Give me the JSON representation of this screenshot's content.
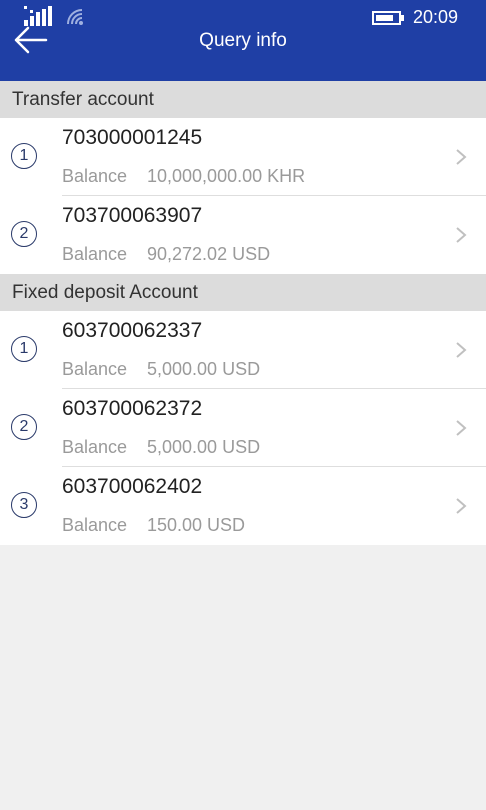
{
  "status": {
    "time": "20:09"
  },
  "header": {
    "title": "Query info"
  },
  "sections": [
    {
      "title": "Transfer account",
      "accounts": [
        {
          "index": "1",
          "number": "703000001245",
          "balance_label": "Balance",
          "balance": "10,000,000.00 KHR"
        },
        {
          "index": "2",
          "number": "703700063907",
          "balance_label": "Balance",
          "balance": "90,272.02 USD"
        }
      ]
    },
    {
      "title": "Fixed deposit Account",
      "accounts": [
        {
          "index": "1",
          "number": "603700062337",
          "balance_label": "Balance",
          "balance": "5,000.00 USD"
        },
        {
          "index": "2",
          "number": "603700062372",
          "balance_label": "Balance",
          "balance": "5,000.00 USD"
        },
        {
          "index": "3",
          "number": "603700062402",
          "balance_label": "Balance",
          "balance": "150.00 USD"
        }
      ]
    }
  ],
  "colors": {
    "header": "#1f3fa5",
    "section": "#dcdcdc",
    "background": "#f0f0f0"
  }
}
